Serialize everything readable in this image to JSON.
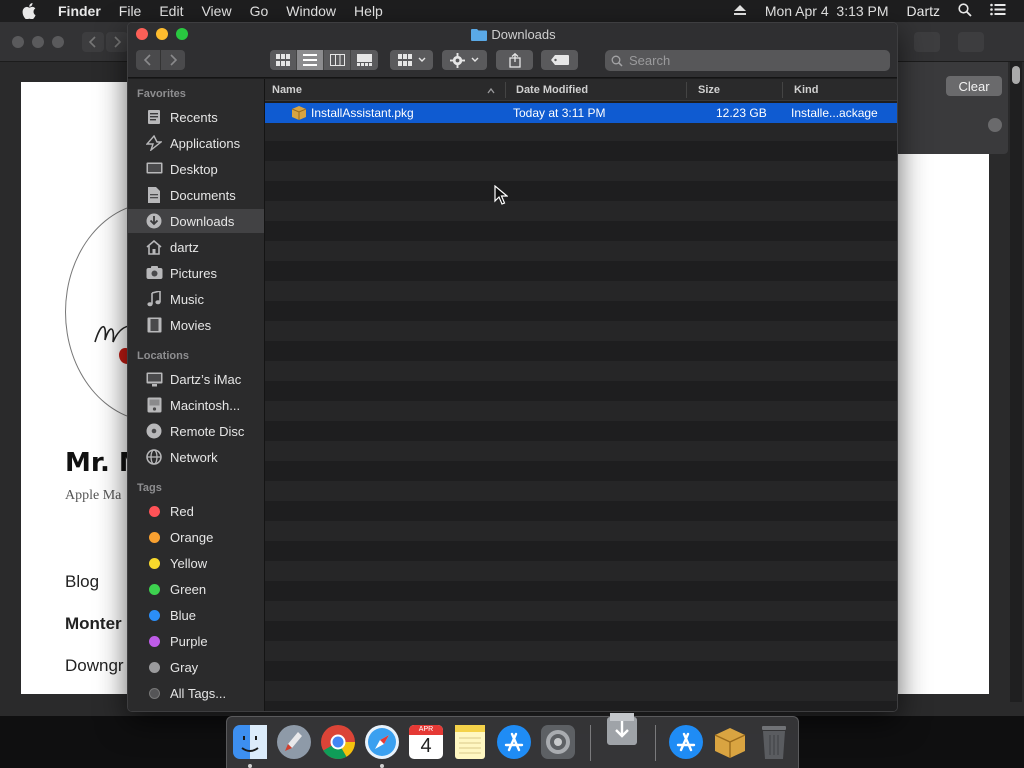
{
  "menubar": {
    "app_name": "Finder",
    "menus": [
      "File",
      "Edit",
      "View",
      "Go",
      "Window",
      "Help"
    ],
    "clock": "Mon Apr 4  3:13 PM",
    "user": "Dartz"
  },
  "background_window": {
    "site_title": "Mr. M",
    "site_subtitle": "Apple Ma",
    "nav_links": [
      "Blog",
      "Monter",
      "Downgr"
    ],
    "clear_button": "Clear"
  },
  "finder": {
    "title": "Downloads",
    "search_placeholder": "Search",
    "sidebar": {
      "favorites_header": "Favorites",
      "favorites": [
        {
          "label": "Recents",
          "icon": "recents-icon"
        },
        {
          "label": "Applications",
          "icon": "applications-icon"
        },
        {
          "label": "Desktop",
          "icon": "desktop-icon"
        },
        {
          "label": "Documents",
          "icon": "documents-icon"
        },
        {
          "label": "Downloads",
          "icon": "downloads-icon",
          "selected": true
        },
        {
          "label": "dartz",
          "icon": "home-icon"
        },
        {
          "label": "Pictures",
          "icon": "pictures-icon"
        },
        {
          "label": "Music",
          "icon": "music-icon"
        },
        {
          "label": "Movies",
          "icon": "movies-icon"
        }
      ],
      "locations_header": "Locations",
      "locations": [
        {
          "label": "Dartz’s iMac",
          "icon": "imac-icon"
        },
        {
          "label": "Macintosh...",
          "icon": "hard-drive-icon"
        },
        {
          "label": "Remote Disc",
          "icon": "disc-icon"
        },
        {
          "label": "Network",
          "icon": "network-icon"
        }
      ],
      "tags_header": "Tags",
      "tags": [
        {
          "label": "Red",
          "color": "#ff5257"
        },
        {
          "label": "Orange",
          "color": "#f8a030"
        },
        {
          "label": "Yellow",
          "color": "#f8d92c"
        },
        {
          "label": "Green",
          "color": "#3dd14f"
        },
        {
          "label": "Blue",
          "color": "#2b8ef8"
        },
        {
          "label": "Purple",
          "color": "#be5ce8"
        },
        {
          "label": "Gray",
          "color": "#9a9a9c"
        },
        {
          "label": "All Tags...",
          "color": "#555557"
        }
      ]
    },
    "columns": {
      "name": "Name",
      "date": "Date Modified",
      "size": "Size",
      "kind": "Kind"
    },
    "files": [
      {
        "name": "InstallAssistant.pkg",
        "date": "Today at 3:11 PM",
        "size": "12.23 GB",
        "kind": "Installe...ackage",
        "selected": true
      }
    ]
  },
  "dock": {
    "apps": [
      "Finder",
      "Launchpad",
      "Chrome",
      "Safari",
      "Calendar",
      "Notes",
      "App Store",
      "System Preferences",
      "Downloads stack",
      "App Store",
      "Installer",
      "Trash"
    ],
    "calendar_month": "APR",
    "calendar_day": "4"
  },
  "colors": {
    "selection": "#0f5bd1",
    "sidebar_bg": "#2b2b2c",
    "window_bg": "#1d1d1e"
  }
}
